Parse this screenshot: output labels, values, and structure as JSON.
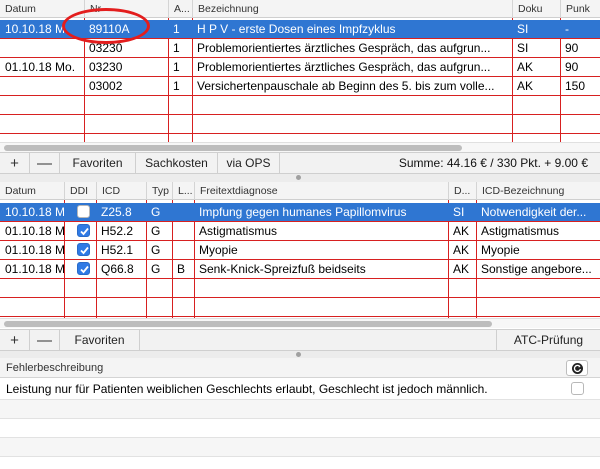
{
  "top_table": {
    "columns": [
      "Datum",
      "Nr",
      "A...",
      "Bezeichnung",
      "Doku",
      "Punk"
    ],
    "rows": [
      {
        "datum": "10.10.18 M",
        "nr": "89110A",
        "a": "1",
        "bez": "H P V - erste Dosen eines Impfzyklus",
        "doku": "SI",
        "punkte": "-"
      },
      {
        "datum": "",
        "nr": "03230",
        "a": "1",
        "bez": "Problemorientiertes ärztliches Gespräch, das aufgrun...",
        "doku": "SI",
        "punkte": "90"
      },
      {
        "datum": "01.10.18  Mo.",
        "nr": "03230",
        "a": "1",
        "bez": "Problemorientiertes ärztliches Gespräch, das aufgrun...",
        "doku": "AK",
        "punkte": "90"
      },
      {
        "datum": "",
        "nr": "03002",
        "a": "1",
        "bez": "Versichertenpauschale ab Beginn des 5. bis zum volle...",
        "doku": "AK",
        "punkte": "150"
      }
    ]
  },
  "top_toolbar": {
    "plus": "+",
    "minus": "—",
    "favoriten": "Favoriten",
    "sachkosten": "Sachkosten",
    "via_ops": "via OPS",
    "summe": "Summe: 44.16 € / 330 Pkt. + 9.00 €"
  },
  "diag_table": {
    "columns": [
      "Datum",
      "DDI",
      "ICD",
      "Typ",
      "L...",
      "Freitextdiagnose",
      "D...",
      "ICD-Bezeichnung"
    ],
    "rows": [
      {
        "datum": "10.10.18 M",
        "ddi": false,
        "icd": "Z25.8",
        "typ": "G",
        "l": "",
        "freitext": "Impfung gegen humanes Papillomvirus",
        "d": "SI",
        "icdbez": "Notwendigkeit der..."
      },
      {
        "datum": "01.10.18 M",
        "ddi": true,
        "icd": "H52.2",
        "typ": "G",
        "l": "",
        "freitext": "Astigmatismus",
        "d": "AK",
        "icdbez": "Astigmatismus"
      },
      {
        "datum": "01.10.18 M",
        "ddi": true,
        "icd": "H52.1",
        "typ": "G",
        "l": "",
        "freitext": "Myopie",
        "d": "AK",
        "icdbez": "Myopie"
      },
      {
        "datum": "01.10.18 M",
        "ddi": true,
        "icd": "Q66.8",
        "typ": "G",
        "l": "B",
        "freitext": "Senk-Knick-Spreizfuß beidseits",
        "d": "AK",
        "icdbez": "Sonstige angebore..."
      }
    ]
  },
  "diag_toolbar": {
    "plus": "+",
    "minus": "—",
    "favoriten": "Favoriten",
    "atc": "ATC-Prüfung"
  },
  "errors": {
    "header": "Fehlerbeschreibung",
    "rows": [
      {
        "text": "Leistung nur für Patienten weiblichen Geschlechts erlaubt, Geschlecht ist jedoch männlich.",
        "checked": false
      }
    ]
  },
  "colors": {
    "selection": "#2f76d2",
    "grid_lines": "#d72020",
    "annotation": "#e31d1d"
  }
}
